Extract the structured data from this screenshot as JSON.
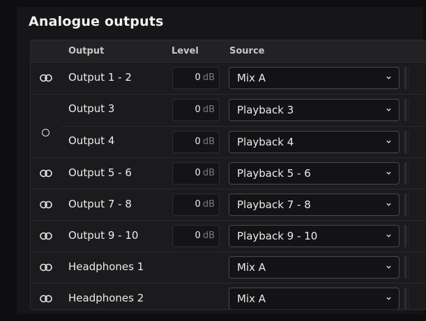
{
  "section": {
    "title": "Analogue outputs"
  },
  "header": {
    "output": "Output",
    "level": "Level",
    "source": "Source"
  },
  "rows": [
    {
      "label": "Output 1 - 2",
      "level": "0",
      "unit": "dB",
      "source": "Mix A",
      "icon": "link-icon"
    },
    {
      "label": "Output 3",
      "level": "0",
      "unit": "dB",
      "source": "Playback 3",
      "icon": "unlink-icon"
    },
    {
      "label": "Output 4",
      "level": "0",
      "unit": "dB",
      "source": "Playback 4",
      "icon": "unlink-icon"
    },
    {
      "label": "Output 5 - 6",
      "level": "0",
      "unit": "dB",
      "source": "Playback 5 - 6",
      "icon": "link-icon"
    },
    {
      "label": "Output 7 - 8",
      "level": "0",
      "unit": "dB",
      "source": "Playback 7 - 8",
      "icon": "link-icon"
    },
    {
      "label": "Output 9 - 10",
      "level": "0",
      "unit": "dB",
      "source": "Playback 9 - 10",
      "icon": "link-icon"
    },
    {
      "label": "Headphones 1",
      "source": "Mix A",
      "icon": "link-icon"
    },
    {
      "label": "Headphones 2",
      "source": "Mix A",
      "icon": "link-icon"
    }
  ],
  "colors": {
    "background": "#161618",
    "table": "#1b1b1d",
    "header": "#222225",
    "select_border": "#4a4a4e"
  }
}
